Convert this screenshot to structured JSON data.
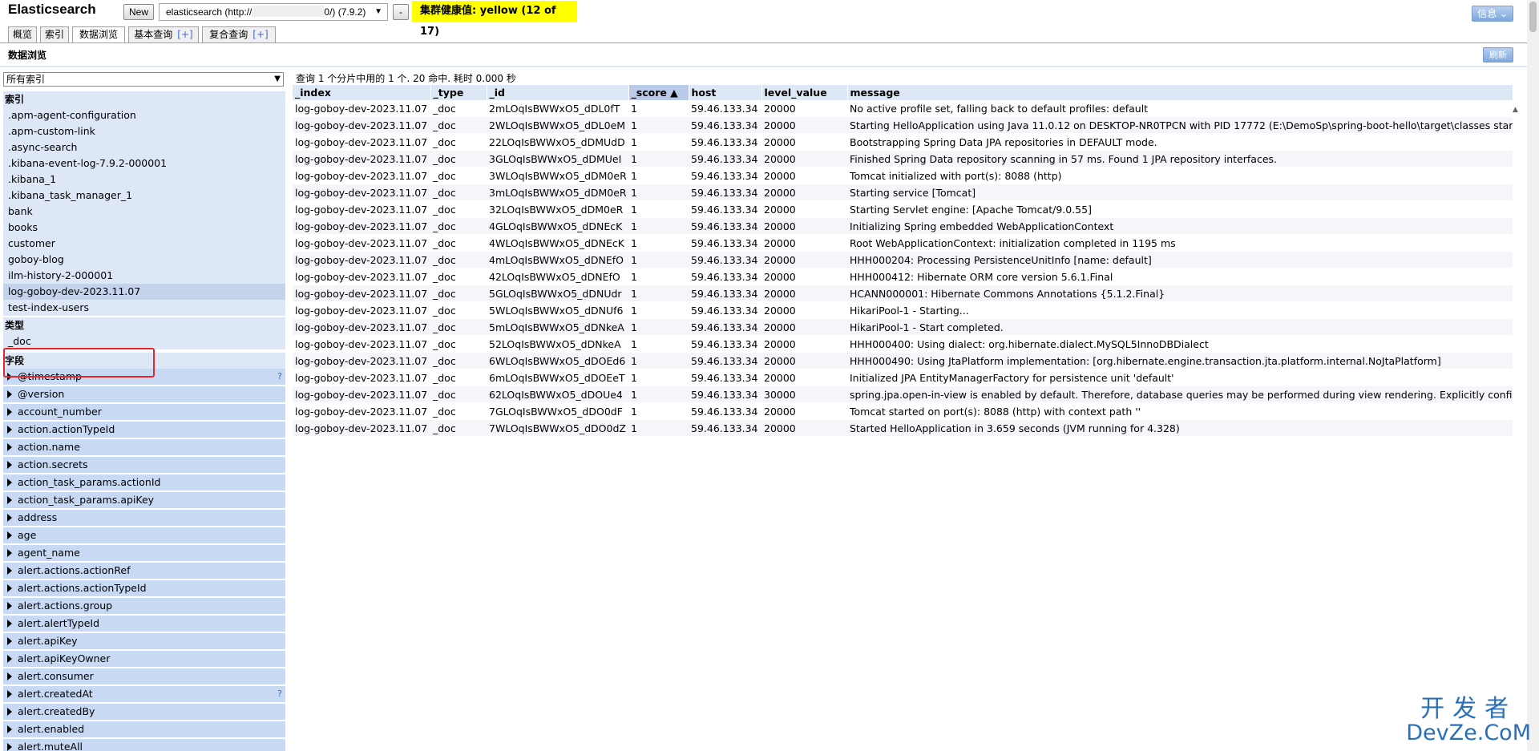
{
  "header": {
    "app_title": "Elasticsearch",
    "new_button": "New",
    "connection_prefix": "elasticsearch (http://",
    "connection_suffix": "0/) (7.9.2)",
    "minus_button": "-",
    "cluster_health": "集群健康值: yellow (12 of 17)",
    "info_button": "信息 ⌄"
  },
  "tabs": [
    {
      "label": "概览",
      "plus": ""
    },
    {
      "label": "索引",
      "plus": ""
    },
    {
      "label": "数据浏览",
      "plus": ""
    },
    {
      "label": "基本查询",
      "plus": "[+]"
    },
    {
      "label": "复合查询",
      "plus": "[+]"
    }
  ],
  "section_title": "数据浏览",
  "refresh_button": "刷新",
  "sidebar": {
    "index_select": "所有索引",
    "indices_heading": "索引",
    "indices": [
      ".apm-agent-configuration",
      ".apm-custom-link",
      ".async-search",
      ".kibana-event-log-7.9.2-000001",
      ".kibana_1",
      ".kibana_task_manager_1",
      "bank",
      "books",
      "customer",
      "goboy-blog",
      "ilm-history-2-000001",
      "log-goboy-dev-2023.11.07",
      "test-index-users"
    ],
    "selected_index": "log-goboy-dev-2023.11.07",
    "types_heading": "类型",
    "types": [
      "_doc"
    ],
    "fields_heading": "字段",
    "fields": [
      {
        "name": "@timestamp",
        "hint": "?"
      },
      {
        "name": "@version",
        "hint": ""
      },
      {
        "name": "account_number",
        "hint": ""
      },
      {
        "name": "action.actionTypeId",
        "hint": ""
      },
      {
        "name": "action.name",
        "hint": ""
      },
      {
        "name": "action.secrets",
        "hint": ""
      },
      {
        "name": "action_task_params.actionId",
        "hint": ""
      },
      {
        "name": "action_task_params.apiKey",
        "hint": ""
      },
      {
        "name": "address",
        "hint": ""
      },
      {
        "name": "age",
        "hint": ""
      },
      {
        "name": "agent_name",
        "hint": ""
      },
      {
        "name": "alert.actions.actionRef",
        "hint": ""
      },
      {
        "name": "alert.actions.actionTypeId",
        "hint": ""
      },
      {
        "name": "alert.actions.group",
        "hint": ""
      },
      {
        "name": "alert.alertTypeId",
        "hint": ""
      },
      {
        "name": "alert.apiKey",
        "hint": ""
      },
      {
        "name": "alert.apiKeyOwner",
        "hint": ""
      },
      {
        "name": "alert.consumer",
        "hint": ""
      },
      {
        "name": "alert.createdAt",
        "hint": "?"
      },
      {
        "name": "alert.createdBy",
        "hint": ""
      },
      {
        "name": "alert.enabled",
        "hint": ""
      },
      {
        "name": "alert.muteAll",
        "hint": ""
      }
    ]
  },
  "results": {
    "summary": "查询 1 个分片中用的 1 个. 20 命中. 耗时 0.000 秒",
    "columns": [
      "_index",
      "_type",
      "_id",
      "_score ▲",
      "host",
      "level_value",
      "message"
    ],
    "rows": [
      [
        "log-goboy-dev-2023.11.07",
        "_doc",
        "2mLOqIsBWWxO5_dDL0fT",
        "1",
        "59.46.133.34",
        "20000",
        "No active profile set, falling back to default profiles: default"
      ],
      [
        "log-goboy-dev-2023.11.07",
        "_doc",
        "2WLOqIsBWWxO5_dDL0eM",
        "1",
        "59.46.133.34",
        "20000",
        "Starting HelloApplication using Java 11.0.12 on DESKTOP-NR0TPCN with PID 17772 (E:\\DemoSp\\spring-boot-hello\\target\\classes started"
      ],
      [
        "log-goboy-dev-2023.11.07",
        "_doc",
        "22LOqIsBWWxO5_dDMUdD",
        "1",
        "59.46.133.34",
        "20000",
        "Bootstrapping Spring Data JPA repositories in DEFAULT mode."
      ],
      [
        "log-goboy-dev-2023.11.07",
        "_doc",
        "3GLOqIsBWWxO5_dDMUeI",
        "1",
        "59.46.133.34",
        "20000",
        "Finished Spring Data repository scanning in 57 ms. Found 1 JPA repository interfaces."
      ],
      [
        "log-goboy-dev-2023.11.07",
        "_doc",
        "3WLOqIsBWWxO5_dDM0eR",
        "1",
        "59.46.133.34",
        "20000",
        "Tomcat initialized with port(s): 8088 (http)"
      ],
      [
        "log-goboy-dev-2023.11.07",
        "_doc",
        "3mLOqIsBWWxO5_dDM0eR",
        "1",
        "59.46.133.34",
        "20000",
        "Starting service [Tomcat]"
      ],
      [
        "log-goboy-dev-2023.11.07",
        "_doc",
        "32LOqIsBWWxO5_dDM0eR",
        "1",
        "59.46.133.34",
        "20000",
        "Starting Servlet engine: [Apache Tomcat/9.0.55]"
      ],
      [
        "log-goboy-dev-2023.11.07",
        "_doc",
        "4GLOqIsBWWxO5_dDNEcK",
        "1",
        "59.46.133.34",
        "20000",
        "Initializing Spring embedded WebApplicationContext"
      ],
      [
        "log-goboy-dev-2023.11.07",
        "_doc",
        "4WLOqIsBWWxO5_dDNEcK",
        "1",
        "59.46.133.34",
        "20000",
        "Root WebApplicationContext: initialization completed in 1195 ms"
      ],
      [
        "log-goboy-dev-2023.11.07",
        "_doc",
        "4mLOqIsBWWxO5_dDNEfO",
        "1",
        "59.46.133.34",
        "20000",
        "HHH000204: Processing PersistenceUnitInfo [name: default]"
      ],
      [
        "log-goboy-dev-2023.11.07",
        "_doc",
        "42LOqIsBWWxO5_dDNEfO",
        "1",
        "59.46.133.34",
        "20000",
        "HHH000412: Hibernate ORM core version 5.6.1.Final"
      ],
      [
        "log-goboy-dev-2023.11.07",
        "_doc",
        "5GLOqIsBWWxO5_dDNUdr",
        "1",
        "59.46.133.34",
        "20000",
        "HCANN000001: Hibernate Commons Annotations {5.1.2.Final}"
      ],
      [
        "log-goboy-dev-2023.11.07",
        "_doc",
        "5WLOqIsBWWxO5_dDNUf6",
        "1",
        "59.46.133.34",
        "20000",
        "HikariPool-1 - Starting..."
      ],
      [
        "log-goboy-dev-2023.11.07",
        "_doc",
        "5mLOqIsBWWxO5_dDNkeA",
        "1",
        "59.46.133.34",
        "20000",
        "HikariPool-1 - Start completed."
      ],
      [
        "log-goboy-dev-2023.11.07",
        "_doc",
        "52LOqIsBWWxO5_dDNkeA",
        "1",
        "59.46.133.34",
        "20000",
        "HHH000400: Using dialect: org.hibernate.dialect.MySQL5InnoDBDialect"
      ],
      [
        "log-goboy-dev-2023.11.07",
        "_doc",
        "6WLOqIsBWWxO5_dDOEd6",
        "1",
        "59.46.133.34",
        "20000",
        "HHH000490: Using JtaPlatform implementation: [org.hibernate.engine.transaction.jta.platform.internal.NoJtaPlatform]"
      ],
      [
        "log-goboy-dev-2023.11.07",
        "_doc",
        "6mLOqIsBWWxO5_dDOEeT",
        "1",
        "59.46.133.34",
        "20000",
        "Initialized JPA EntityManagerFactory for persistence unit 'default'"
      ],
      [
        "log-goboy-dev-2023.11.07",
        "_doc",
        "62LOqIsBWWxO5_dDOUe4",
        "1",
        "59.46.133.34",
        "30000",
        "spring.jpa.open-in-view is enabled by default. Therefore, database queries may be performed during view rendering. Explicitly configure"
      ],
      [
        "log-goboy-dev-2023.11.07",
        "_doc",
        "7GLOqIsBWWxO5_dDO0dF",
        "1",
        "59.46.133.34",
        "20000",
        "Tomcat started on port(s): 8088 (http) with context path ''"
      ],
      [
        "log-goboy-dev-2023.11.07",
        "_doc",
        "7WLOqIsBWWxO5_dDO0dZ",
        "1",
        "59.46.133.34",
        "20000",
        "Started HelloApplication in 3.659 seconds (JVM running for 4.328)"
      ]
    ]
  },
  "watermark": {
    "line1": "开发者",
    "line2": "DevZe.CoM"
  },
  "colors": {
    "health": "#ffff00",
    "panel": "#dde7f6",
    "field": "#c8d9f3",
    "highlight": "#e8262a"
  }
}
